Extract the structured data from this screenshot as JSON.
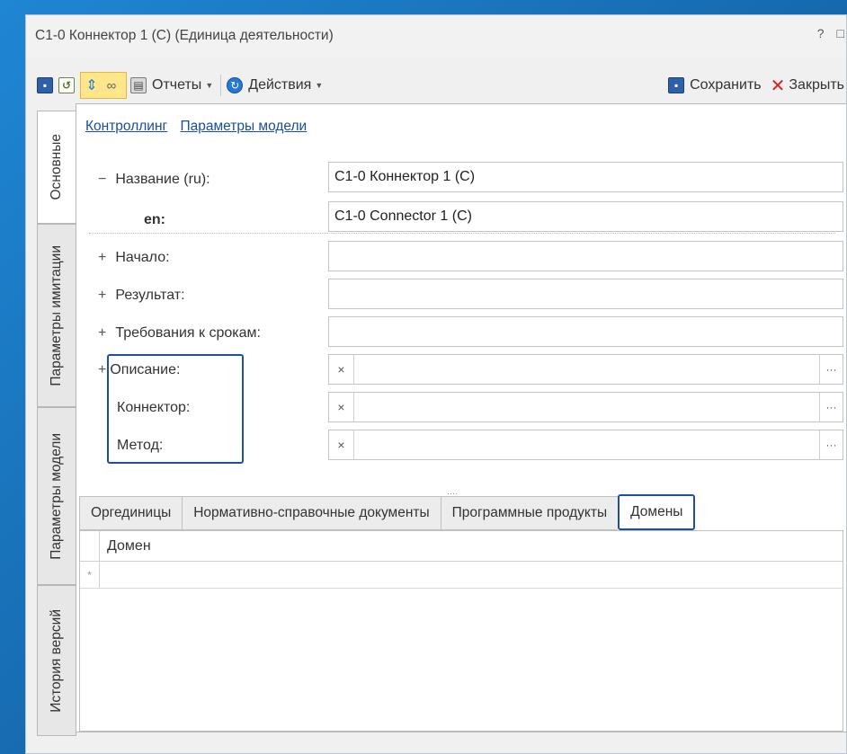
{
  "window": {
    "title": "С1-0 Коннектор 1 (С) (Единица деятельности)",
    "help_label": "?",
    "restore_label": "□"
  },
  "toolbar": {
    "reports_label": "Отчеты",
    "actions_label": "Действия",
    "save_label": "Сохранить",
    "close_label": "Закрыть"
  },
  "side_tabs": [
    {
      "label": "Основные",
      "active": true
    },
    {
      "label": "Параметры имитации"
    },
    {
      "label": "Параметры модели"
    },
    {
      "label": "История версий"
    }
  ],
  "links": [
    "Контроллинг",
    "Параметры модели"
  ],
  "form": {
    "name_label": "Название (ru):",
    "name_value": "С1-0 Коннектор 1 (С)",
    "en_label": "en:",
    "en_value": "С1-0 Connector 1 (C)",
    "start_label": "Начало:",
    "start_value": "",
    "result_label": "Результат:",
    "result_value": "",
    "deadline_label": "Требования к срокам:",
    "deadline_value": "",
    "description_label": "Описание:",
    "connector_label": "Коннектор:",
    "method_label": "Метод:",
    "minus_sign": "−",
    "plus_sign": "+",
    "clear_glyph": "×",
    "browse_glyph": "···"
  },
  "splitter_glyph": "....",
  "bottom_tabs": [
    {
      "label": "Оргединицы"
    },
    {
      "label": "Нормативно-справочные документы"
    },
    {
      "label": "Программные продукты"
    },
    {
      "label": "Домены",
      "active": true
    }
  ],
  "grid": {
    "columns": [
      "Домен"
    ],
    "new_row_marker": "*"
  },
  "colors": {
    "highlight": "#1c4fa0",
    "link": "#1a4ea0",
    "background": "#1a78c2"
  }
}
